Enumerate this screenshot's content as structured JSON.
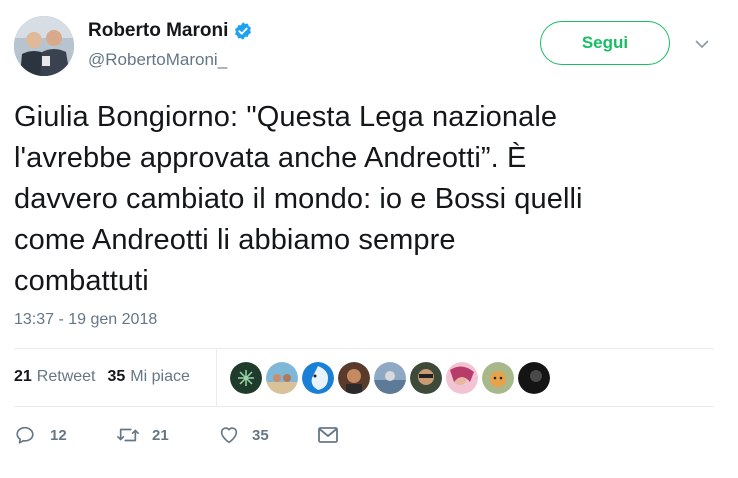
{
  "user": {
    "name": "Roberto Maroni",
    "handle": "@RobertoMaroni_",
    "verified_icon": "verified-badge-icon"
  },
  "follow_label": "Segui",
  "tweet": {
    "text": "Giulia Bongiorno: \"Questa Lega nazionale\nl'avrebbe approvata anche Andreotti”. È\ndavvero cambiato il mondo: io e Bossi quelli\ncome Andreotti li abbiamo sempre\ncombattuti",
    "timestamp": "13:37 - 19 gen 2018"
  },
  "stats": {
    "retweets_count": "21",
    "retweets_label": "Retweet",
    "likes_count": "35",
    "likes_label": "Mi piace"
  },
  "actions": {
    "reply_count": "12",
    "retweet_count": "21",
    "like_count": "35"
  },
  "colors": {
    "follow_green": "#17bf63",
    "verified_blue": "#1da1f2",
    "secondary_text": "#657786"
  }
}
